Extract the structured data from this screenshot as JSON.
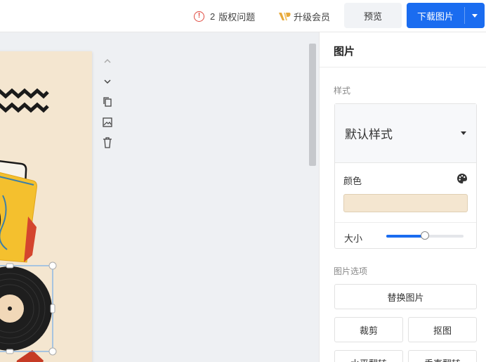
{
  "topbar": {
    "issues_count": "2",
    "issues_label": "版权问题",
    "upgrade_label": "升级会员",
    "preview_label": "预览",
    "download_label": "下载图片"
  },
  "panel": {
    "title": "图片",
    "style_section_label": "样式",
    "style_select_value": "默认样式",
    "color_label": "颜色",
    "color_value": "#f4e6d0",
    "size_label": "大小",
    "size_value_fraction": 0.5,
    "image_options_label": "图片选项",
    "replace_image_label": "替换图片",
    "crop_label": "裁剪",
    "cutout_label": "抠图",
    "flip_horizontal_label": "水平翻转",
    "flip_vertical_label": "垂直翻转"
  },
  "colors": {
    "accent": "#1a6cf0",
    "warning": "#e04a3f",
    "vip_gold": "#e7a93b",
    "canvas_bg": "#f4e6d0"
  },
  "icons": {
    "issue": "warning-circle-icon",
    "vip": "vip-crown-icon",
    "tools": [
      "chevron-up-icon",
      "chevron-down-icon",
      "copy-icon",
      "image-icon",
      "trash-icon"
    ],
    "palette": "palette-icon"
  }
}
